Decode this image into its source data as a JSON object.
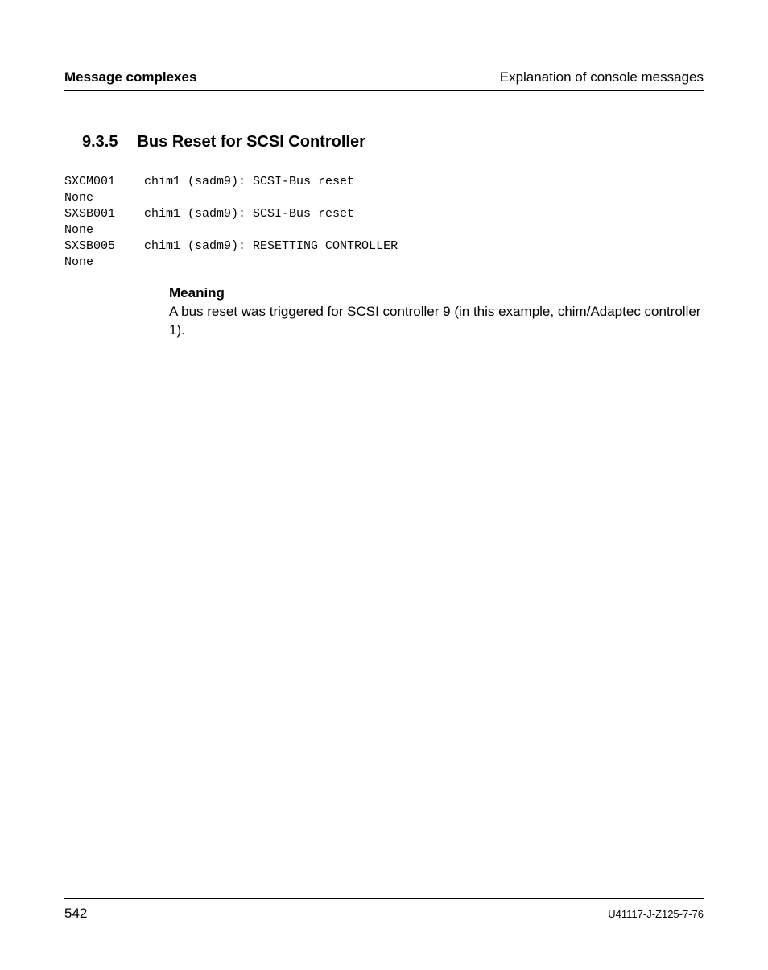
{
  "header": {
    "left": "Message complexes",
    "right": "Explanation of console messages"
  },
  "section": {
    "number": "9.3.5",
    "title": "Bus Reset for SCSI Controller"
  },
  "code": "SXCM001    chim1 (sadm9): SCSI-Bus reset\nNone\nSXSB001    chim1 (sadm9): SCSI-Bus reset\nNone\nSXSB005    chim1 (sadm9): RESETTING CONTROLLER\nNone",
  "meaning": {
    "label": "Meaning",
    "text": "A bus reset was triggered for SCSI controller 9 (in this example, chim/Adaptec controller 1)."
  },
  "footer": {
    "page": "542",
    "docid": "U41117-J-Z125-7-76"
  }
}
